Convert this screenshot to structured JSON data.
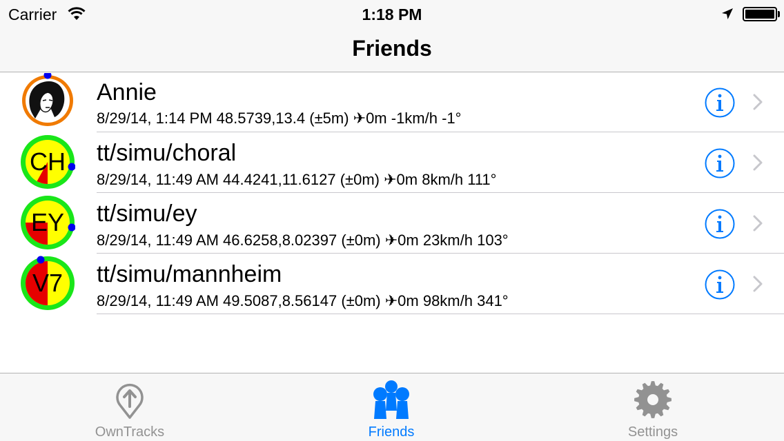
{
  "status_bar": {
    "carrier": "Carrier",
    "time": "1:18 PM",
    "icons": [
      "wifi-icon",
      "location-arrow-icon",
      "battery-icon"
    ]
  },
  "nav": {
    "title": "Friends"
  },
  "friends": [
    {
      "name": "Annie",
      "detail": "8/29/14, 1:14 PM 48.5739,13.4 (±5m) ✈0m -1km/h -1°",
      "avatar_type": "photo",
      "ring_color": "#f07a00"
    },
    {
      "name": "tt/simu/choral",
      "detail": "8/29/14, 11:49 AM 44.4241,11.6127 (±0m) ✈0m 8km/h 111°",
      "avatar_type": "initials",
      "initials": "CH",
      "ring_color": "#19e619",
      "fill_color": "#ffff00",
      "red_fraction": 0.08
    },
    {
      "name": "tt/simu/ey",
      "detail": "8/29/14, 11:49 AM 46.6258,8.02397 (±0m) ✈0m 23km/h 103°",
      "avatar_type": "initials",
      "initials": "EY",
      "ring_color": "#19e619",
      "fill_color": "#ffff00",
      "red_fraction": 0.25
    },
    {
      "name": "tt/simu/mannheim",
      "detail": "8/29/14, 11:49 AM 49.5087,8.56147 (±0m) ✈0m 98km/h 341°",
      "avatar_type": "initials",
      "initials": "V7",
      "ring_color": "#19e619",
      "fill_color": "#ffff00",
      "red_fraction": 0.5
    }
  ],
  "tabs": [
    {
      "label": "OwnTracks",
      "icon": "owntracks-pin-icon",
      "selected": false
    },
    {
      "label": "Friends",
      "icon": "friends-group-icon",
      "selected": true
    },
    {
      "label": "Settings",
      "icon": "gear-icon",
      "selected": false
    }
  ],
  "colors": {
    "accent": "#007aff",
    "inactive_tab": "#929292",
    "marker_blue": "#0000ee",
    "red": "#e60000"
  }
}
